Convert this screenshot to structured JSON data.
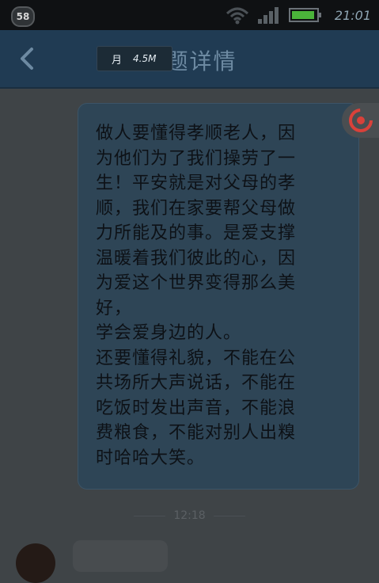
{
  "status_bar": {
    "notification_count": "58",
    "time": "21:01",
    "icons": [
      "wifi-icon",
      "signal-icon",
      "battery-icon"
    ]
  },
  "title_bar": {
    "title": "话题详情",
    "back_icon": "chevron-left-icon"
  },
  "speed_widget": {
    "label": "月",
    "value": "4.5M"
  },
  "message": {
    "text": "做人要懂得孝顺老人，因\n为他们为了我们操劳了一\n生！平安就是对父母的孝\n顺，我们在家要帮父母做\n力所能及的事。是爱支撑\n温暖着我们彼此的心，因\n为爱这个世界变得那么美\n好，\n学会爱身边的人。\n还要懂得礼貌，不能在公\n共场所大声说话，不能在\n吃饭时发出声音，不能浪\n费粮食，不能对别人出糗\n时哈哈大笑。",
    "timestamp": "12:18"
  },
  "colors": {
    "title_bar": "#203b53",
    "bubble": "#2e4556",
    "background": "#3f4447",
    "accent": "#d9413a"
  }
}
